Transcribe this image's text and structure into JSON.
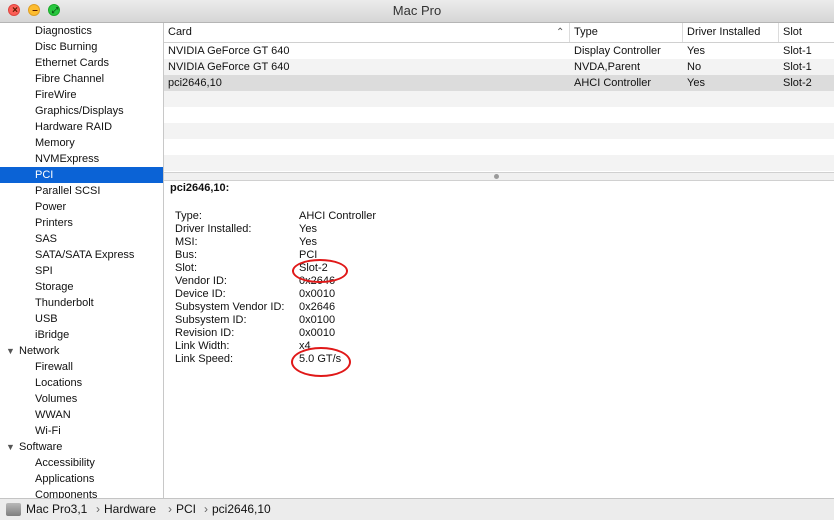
{
  "window": {
    "title": "Mac Pro"
  },
  "sidebar": {
    "items": [
      {
        "label": "Diagnostics",
        "type": "child"
      },
      {
        "label": "Disc Burning",
        "type": "child"
      },
      {
        "label": "Ethernet Cards",
        "type": "child"
      },
      {
        "label": "Fibre Channel",
        "type": "child"
      },
      {
        "label": "FireWire",
        "type": "child"
      },
      {
        "label": "Graphics/Displays",
        "type": "child"
      },
      {
        "label": "Hardware RAID",
        "type": "child"
      },
      {
        "label": "Memory",
        "type": "child"
      },
      {
        "label": "NVMExpress",
        "type": "child"
      },
      {
        "label": "PCI",
        "type": "child",
        "selected": true
      },
      {
        "label": "Parallel SCSI",
        "type": "child"
      },
      {
        "label": "Power",
        "type": "child"
      },
      {
        "label": "Printers",
        "type": "child"
      },
      {
        "label": "SAS",
        "type": "child"
      },
      {
        "label": "SATA/SATA Express",
        "type": "child"
      },
      {
        "label": "SPI",
        "type": "child"
      },
      {
        "label": "Storage",
        "type": "child"
      },
      {
        "label": "Thunderbolt",
        "type": "child"
      },
      {
        "label": "USB",
        "type": "child"
      },
      {
        "label": "iBridge",
        "type": "child"
      },
      {
        "label": "Network",
        "type": "group"
      },
      {
        "label": "Firewall",
        "type": "child"
      },
      {
        "label": "Locations",
        "type": "child"
      },
      {
        "label": "Volumes",
        "type": "child"
      },
      {
        "label": "WWAN",
        "type": "child"
      },
      {
        "label": "Wi-Fi",
        "type": "child"
      },
      {
        "label": "Software",
        "type": "group"
      },
      {
        "label": "Accessibility",
        "type": "child"
      },
      {
        "label": "Applications",
        "type": "child"
      },
      {
        "label": "Components",
        "type": "child"
      }
    ]
  },
  "table": {
    "columns": [
      "Card",
      "Type",
      "Driver Installed",
      "Slot"
    ],
    "rows": [
      [
        "NVIDIA GeForce GT 640",
        "Display Controller",
        "Yes",
        "Slot-1"
      ],
      [
        "NVIDIA GeForce GT 640",
        "NVDA,Parent",
        "No",
        "Slot-1"
      ],
      [
        "pci2646,10",
        "AHCI Controller",
        "Yes",
        "Slot-2"
      ]
    ],
    "selected_row": 2
  },
  "detail": {
    "title": "pci2646,10:",
    "properties": [
      {
        "key": "Type:",
        "value": "AHCI Controller"
      },
      {
        "key": "Driver Installed:",
        "value": "Yes"
      },
      {
        "key": "MSI:",
        "value": "Yes"
      },
      {
        "key": "Bus:",
        "value": "PCI"
      },
      {
        "key": "Slot:",
        "value": "Slot-2"
      },
      {
        "key": "Vendor ID:",
        "value": "0x2646"
      },
      {
        "key": "Device ID:",
        "value": "0x0010"
      },
      {
        "key": "Subsystem Vendor ID:",
        "value": "0x2646"
      },
      {
        "key": "Subsystem ID:",
        "value": "0x0100"
      },
      {
        "key": "Revision ID:",
        "value": "0x0010"
      },
      {
        "key": "Link Width:",
        "value": "x4"
      },
      {
        "key": "Link Speed:",
        "value": "5.0 GT/s"
      }
    ]
  },
  "breadcrumb": [
    "Mac Pro3,1",
    "Hardware",
    "PCI",
    "pci2646,10"
  ],
  "colors": {
    "selection": "#0b63d6",
    "annotation": "#e01818"
  }
}
